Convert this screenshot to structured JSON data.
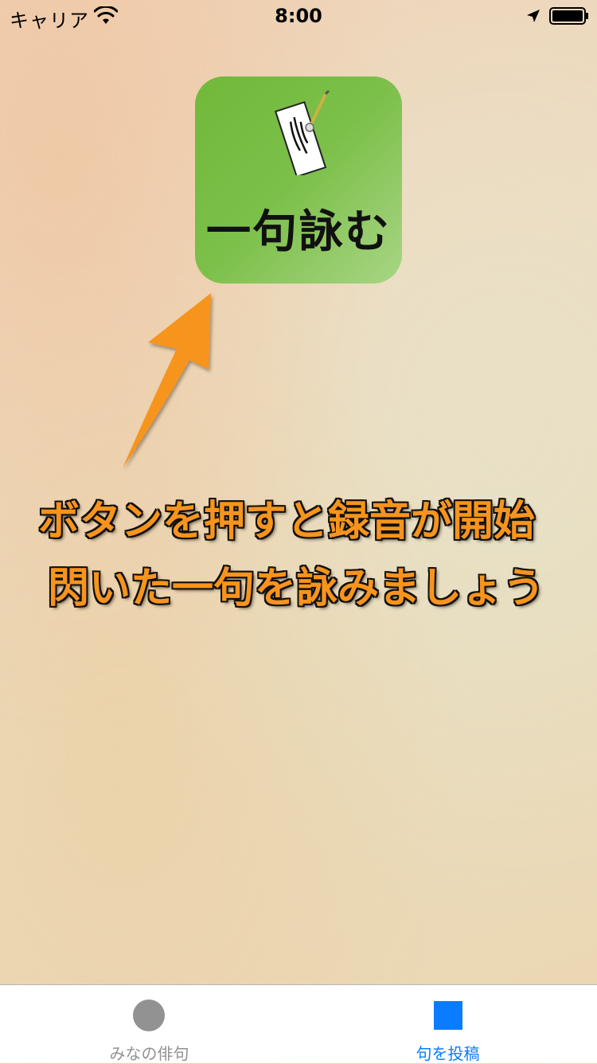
{
  "status_bar": {
    "carrier": "キャリア",
    "time": "8:00",
    "wifi_icon": "wifi-icon",
    "location_icon": "location-arrow-icon",
    "battery_icon": "battery-full-icon"
  },
  "record_button": {
    "label": "一句詠む",
    "icon": "tanzaku-brush-icon",
    "color": "#7cc04a"
  },
  "instruction": {
    "line1": "ボタンを押すと録音が開始",
    "line2": "閃いた一句を詠みましょう",
    "color": "#f7941d"
  },
  "tab_bar": {
    "tabs": [
      {
        "label": "みなの俳句",
        "icon": "circle-icon",
        "selected": false,
        "color": "#929292"
      },
      {
        "label": "句を投稿",
        "icon": "square-icon",
        "selected": true,
        "color": "#0a7cff"
      }
    ]
  }
}
